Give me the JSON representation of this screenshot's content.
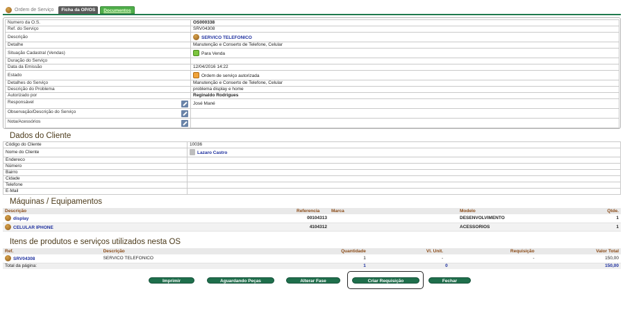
{
  "tabs": {
    "main": "Ordem de Serviço",
    "ficha": "Ficha da OP/OS",
    "documentos": "Documentos"
  },
  "os_details": [
    {
      "label": "Numero da O.S.",
      "value": "OS000338",
      "style": "bold"
    },
    {
      "label": "Ref. do Serviço",
      "value": "SRV04308"
    },
    {
      "label": "Descrição",
      "value": "SERVICO TELEFONICO",
      "style": "link",
      "icon": "service-icon"
    },
    {
      "label": "Detalhe",
      "value": "Manutenção e Conserto de Telefone, Celular"
    },
    {
      "label": "Situação Cadastral (Vendas)",
      "value": "Para Venda",
      "icon": "check-status-icon"
    },
    {
      "label": "Duração do Serviço",
      "value": ""
    },
    {
      "label": "Data da Emissão",
      "value": "12/04/2016 14:22"
    },
    {
      "label": "Estado",
      "value": "Ordem de serviço autorizada",
      "icon": "status-authorized-icon"
    },
    {
      "label": "Detalhes do Serviço",
      "value": "Manutenção e Conserto de Telefone, Celular"
    },
    {
      "label": "Descrição do Problema",
      "value": "problema display e home"
    },
    {
      "label": "Autorizado por",
      "value": "Reginaldo Rodrigues",
      "style": "bold"
    },
    {
      "label": "Responsável",
      "value": "José Mané",
      "editable": true
    },
    {
      "label": "Observação/Descrição do Serviço",
      "value": "",
      "editable": true
    },
    {
      "label": "Nota/Acessórios",
      "value": "",
      "editable": true
    }
  ],
  "client_section": {
    "title": "Dados do Cliente",
    "fields": [
      {
        "label": "Código do Cliente",
        "value": "10036"
      },
      {
        "label": "Nome do Cliente",
        "value": "Lazaro Castro",
        "style": "link",
        "icon": "client-icon"
      },
      {
        "label": "Endereco",
        "value": ""
      },
      {
        "label": "Número",
        "value": ""
      },
      {
        "label": "Bairro",
        "value": ""
      },
      {
        "label": "Cidade",
        "value": ""
      },
      {
        "label": "Telefone",
        "value": ""
      },
      {
        "label": "E-Mail",
        "value": ""
      }
    ]
  },
  "machines_section": {
    "title": "Máquinas / Equipamentos",
    "headers": {
      "descricao": "Descrição",
      "referencia": "Referencia",
      "marca": "Marca",
      "modelo": "Modelo",
      "qtde": "Qtde."
    },
    "rows": [
      {
        "descricao": "display",
        "referencia": "00104313",
        "marca": "",
        "modelo": "DESENVOLVIMENTO",
        "qtde": "1"
      },
      {
        "descricao": "CELULAR IPHONE",
        "referencia": "4104312",
        "marca": "",
        "modelo": "ACESSORIOS",
        "qtde": "1"
      }
    ]
  },
  "items_section": {
    "title": "Itens de produtos e serviços utilizados nesta OS",
    "headers": {
      "ref": "Ref.",
      "descricao": "Descrição",
      "quantidade": "Quantidade",
      "vl_unit": "Vl. Unit.",
      "requisicao": "Requisição",
      "valor_total": "Valor Total"
    },
    "rows": [
      {
        "ref": "SRV04308",
        "descricao": "SERVICO TELEFONICO",
        "quantidade": "1",
        "vl_unit": "-",
        "requisicao": "-",
        "valor_total": "150,00"
      }
    ],
    "total": {
      "label": "Total da página:",
      "quantidade": "1",
      "requisicao": "0",
      "valor_total": "150,00"
    }
  },
  "buttons": {
    "imprimir": "Imprimir",
    "aguardando": "Aguardando Peças",
    "alterar_fase": "Alterar Fase",
    "criar_requisicao": "Criar Requisição",
    "fechar": "Fechar"
  },
  "colors": {
    "primary_green": "#1f6f4c",
    "tab_green": "#4fae4a",
    "header_text": "#8a4a16",
    "link_blue": "#1d2f9e"
  }
}
